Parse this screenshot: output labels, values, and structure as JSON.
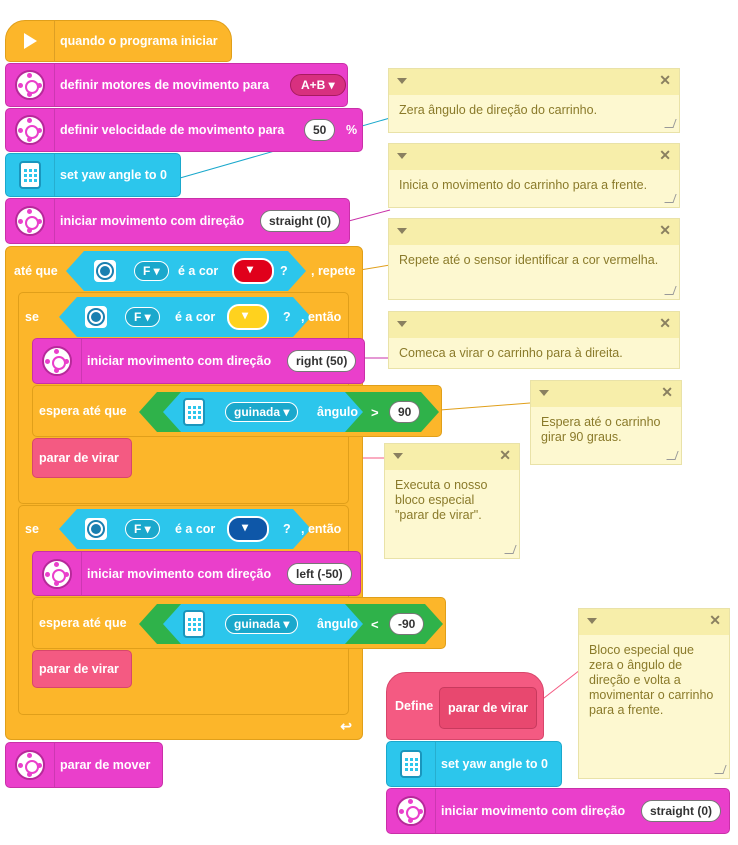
{
  "program": {
    "start": {
      "label": "quando o programa iniciar"
    },
    "set_motors": {
      "label": "definir motores de movimento para",
      "value": "A+B"
    },
    "set_speed": {
      "label": "definir velocidade de movimento para",
      "value": "50",
      "unit": "%"
    },
    "yaw_reset": {
      "label": "set yaw angle to 0"
    },
    "start_move": {
      "label": "iniciar movimento com direção",
      "value": "straight (0)"
    },
    "repeat_until": {
      "prefix": "até que",
      "port": "F",
      "middle": "é a cor",
      "q": "?",
      "suffix": ", repete",
      "color": "#e0001b"
    },
    "if1": {
      "prefix": "se",
      "port": "F",
      "middle": "é a cor",
      "q": "?",
      "suffix": ", então",
      "color": "#ffd21e"
    },
    "move_right": {
      "label": "iniciar movimento com direção",
      "value": "right (50)"
    },
    "wait1": {
      "label": "espera até que",
      "sensor": "guinada",
      "property": "ângulo",
      "op": ">",
      "value": "90"
    },
    "stop_turn1": {
      "label": "parar de virar"
    },
    "if2": {
      "prefix": "se",
      "port": "F",
      "middle": "é a cor",
      "q": "?",
      "suffix": ", então",
      "color": "#0e57a8"
    },
    "move_left": {
      "label": "iniciar movimento com direção",
      "value": "left (-50)"
    },
    "wait2": {
      "label": "espera até que",
      "sensor": "guinada",
      "property": "ângulo",
      "op": "<",
      "value": "-90"
    },
    "stop_turn2": {
      "label": "parar de virar"
    },
    "stop_move": {
      "label": "parar de mover"
    },
    "define": {
      "label": "Define",
      "name": "parar de virar"
    },
    "def_yaw": {
      "label": "set yaw angle to 0"
    },
    "def_move": {
      "label": "iniciar movimento com direção",
      "value": "straight (0)"
    }
  },
  "comments": [
    "Zera ângulo de direção do carrinho.",
    "Inicia o movimento do carrinho para a frente.",
    "Repete até o sensor identificar a cor vermelha.",
    "Comeca a virar o carrinho para à direita.",
    "Espera até o carrinho girar 90 graus.",
    "Executa o nosso bloco especial \"parar de virar\".",
    "Bloco especial que zera o ângulo de direção e volta a movimentar o carrinho para a frente."
  ],
  "colors": {
    "motion": "#ea3fcb",
    "sensor": "#2cc6ec",
    "control": "#fcb62a",
    "myblocks": "#f45a82",
    "operator": "#2fb24a"
  }
}
